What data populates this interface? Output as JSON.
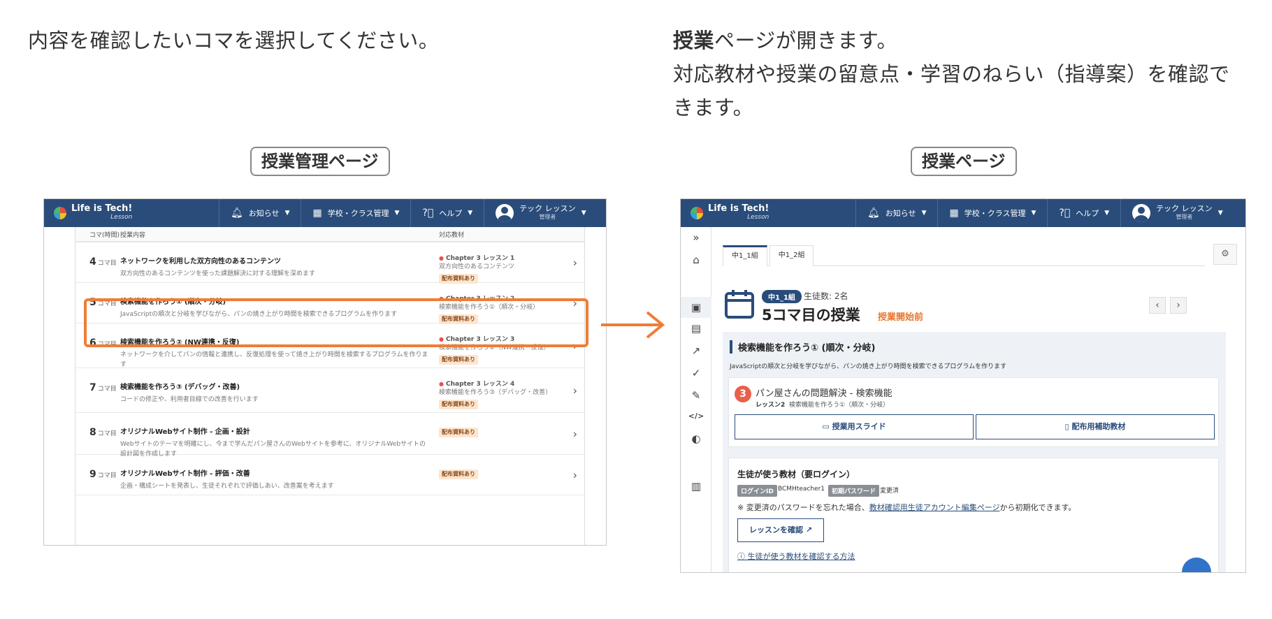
{
  "instructions": {
    "left": "内容を確認したいコマを選択してください。",
    "right_bold": "授業",
    "right_rest": "ページが開きます。",
    "right_line2": "対応教材や授業の留意点・学習のねらい（指導案）を確認できます。"
  },
  "captions": {
    "left": "授業管理ページ",
    "right": "授業ページ"
  },
  "navbar": {
    "logo": "Life is Tech!",
    "logo_sub": "Lesson",
    "notifications": "お知らせ",
    "school": "学校・クラス管理",
    "help": "ヘルプ",
    "user_name": "テック レッスン",
    "user_role": "管理者"
  },
  "table": {
    "headers": {
      "koma": "コマ(時間)",
      "content": "授業内容",
      "material": "対応教材"
    },
    "koma_suffix": "コマ目",
    "rows": [
      {
        "num": "4",
        "title": "ネットワークを利用した双方向性のあるコンテンツ",
        "desc": "双方向性のあるコンテンツを使った課題解決に対する理解を深めます",
        "chapter": "Chapter 3 レッスン 1",
        "mat_desc": "双方向性のあるコンテンツ",
        "badge": "配布資料あり"
      },
      {
        "num": "5",
        "title": "検索機能を作ろう① (順次・分岐)",
        "desc": "JavaScriptの順次と分岐を学びながら、パンの焼き上がり時間を検索できるプログラムを作ります",
        "chapter": "Chapter 3 レッスン 2",
        "mat_desc": "検索機能を作ろう①（順次・分岐）",
        "badge": "配布資料あり"
      },
      {
        "num": "6",
        "title": "検索機能を作ろう② (NW連携・反復)",
        "desc": "ネットワークを介してパンの情報と連携し、反復処理を使って焼き上がり時間を検索するプログラムを作ります",
        "chapter": "Chapter 3 レッスン 3",
        "mat_desc": "検索機能を作ろう②（NW連携・反復）",
        "badge": "配布資料あり"
      },
      {
        "num": "7",
        "title": "検索機能を作ろう③ (デバッグ・改善)",
        "desc": "コードの修正や、利用者目線での改善を行います",
        "chapter": "Chapter 3 レッスン 4",
        "mat_desc": "検索機能を作ろう③（デバッグ・改善）",
        "badge": "配布資料あり"
      },
      {
        "num": "8",
        "title": "オリジナルWebサイト制作 - 企画・設計",
        "desc": "Webサイトのテーマを明確にし、今まで学んだパン屋さんのWebサイトを参考に、オリジナルWebサイトの設計図を作成します",
        "chapter": "",
        "mat_desc": "",
        "badge": "配布資料あり"
      },
      {
        "num": "9",
        "title": "オリジナルWebサイト制作 - 評価・改善",
        "desc": "企画・構成シートを発表し、生徒それぞれで評価しあい、改善案を考えます",
        "chapter": "",
        "mat_desc": "",
        "badge": "配布資料あり"
      }
    ]
  },
  "lesson_page": {
    "tabs": [
      "中1_1組",
      "中1_2組"
    ],
    "class_badge": "中1_1組",
    "student_count": "生徒数: 2名",
    "heading": "5コマ目の授業",
    "status": "授業開始前",
    "panel_title": "検索機能を作ろう① (順次・分岐)",
    "panel_desc": "JavaScriptの順次と分岐を学びながら、パンの焼き上がり時間を検索できるプログラムを作ります",
    "material": {
      "num": "3",
      "title": "パン屋さんの問題解決 - 検索機能",
      "lesson_label": "レッスン2",
      "lesson_name": "検索機能を作ろう①（順次・分岐）",
      "slide_button": "授業用スライド",
      "handout_button": "配布用補助教材"
    },
    "student_materials": {
      "title": "生徒が使う教材（要ログイン）",
      "login_id_label": "ログインID",
      "login_id_value": "BCMHteacher1",
      "init_pw_label": "初期パスワード",
      "init_pw_value": "変更済",
      "note_prefix": "※ 変更済のパスワードを忘れた場合、",
      "note_link": "教材確認用生徒アカウント編集ページ",
      "note_suffix": "から初期化できます。",
      "confirm_button": "レッスンを確認",
      "help_link": "生徒が使う教材を確認する方法"
    }
  },
  "colors": {
    "navy": "#2a4c7a",
    "orange": "#ee7d34",
    "accent_red": "#e8514e"
  }
}
